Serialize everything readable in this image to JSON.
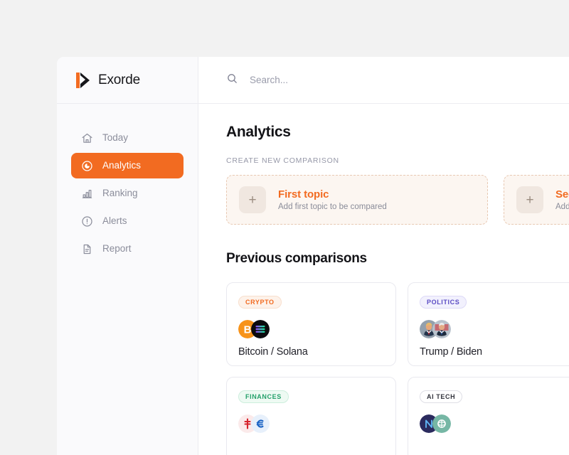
{
  "brand": {
    "name": "Exorde",
    "logo_icon": "exorde-logo-icon"
  },
  "sidebar": {
    "items": [
      {
        "label": "Today",
        "icon": "home-icon",
        "active": false
      },
      {
        "label": "Analytics",
        "icon": "pie-target-icon",
        "active": true
      },
      {
        "label": "Ranking",
        "icon": "bar-chart-icon",
        "active": false
      },
      {
        "label": "Alerts",
        "icon": "alert-circle-icon",
        "active": false
      },
      {
        "label": "Report",
        "icon": "document-icon",
        "active": false
      }
    ]
  },
  "topbar": {
    "search_placeholder": "Search...",
    "search_value": "",
    "search_icon": "search-icon"
  },
  "main": {
    "page_title": "Analytics",
    "create_section_label": "CREATE NEW COMPARISON",
    "new_comparison": [
      {
        "title": "First topic",
        "subtitle": "Add first topic to be compared",
        "plus": "+"
      },
      {
        "title": "Second topic",
        "subtitle": "Add second topic to be compared",
        "plus": "+"
      }
    ],
    "previous_title": "Previous comparisons",
    "comparisons": [
      {
        "badge": "CRYPTO",
        "badge_style": "crypto",
        "title": "Bitcoin / Solana",
        "icons": [
          "bitcoin-icon",
          "solana-icon"
        ]
      },
      {
        "badge": "POLITICS",
        "badge_style": "politics",
        "title": "Trump / Biden",
        "icons": [
          "trump-avatar",
          "biden-avatar"
        ]
      },
      {
        "badge": "FINANCES",
        "badge_style": "finances",
        "title": "",
        "icons": [
          "bank-red-icon",
          "bank-blue-icon"
        ]
      },
      {
        "badge": "AI TECH",
        "badge_style": "aitech",
        "title": "",
        "icons": [
          "ai-navy-icon",
          "ai-teal-icon"
        ]
      }
    ]
  },
  "colors": {
    "accent": "#f26b21",
    "page_background": "#f2f2f2",
    "sidebar_background": "#fafafc",
    "crypto": "#f26b21",
    "politics": "#5b4cc4",
    "finances": "#23a06a",
    "aitech": "#33343d"
  }
}
